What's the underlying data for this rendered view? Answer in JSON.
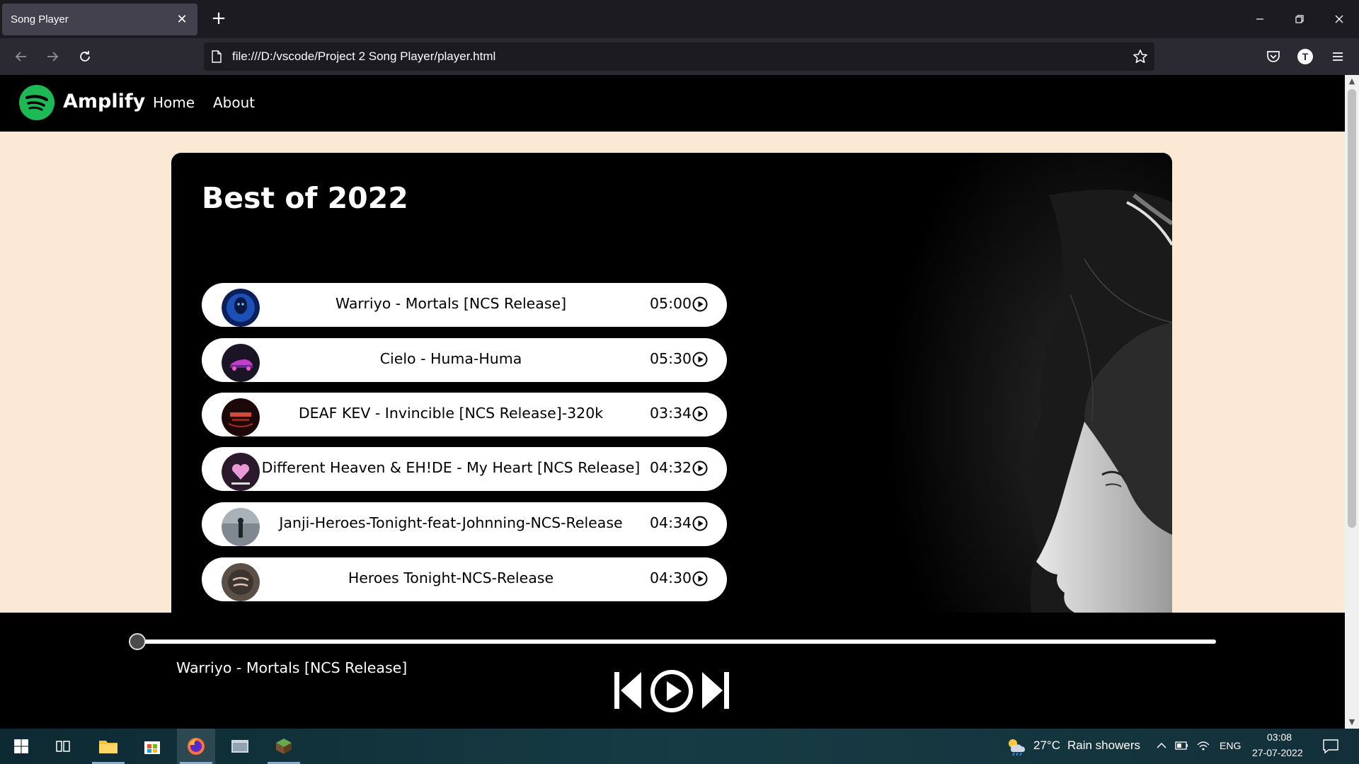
{
  "browser": {
    "tab_title": "Song Player",
    "tab_close": "✕",
    "new_tab": "+",
    "url": "file:///D:/vscode/Project 2 Song Player/player.html",
    "account_initial": "T"
  },
  "site": {
    "brand": "Amplify",
    "nav": [
      "Home",
      "About"
    ],
    "brand_color": "#1db954",
    "page_bg": "#fbe9d6"
  },
  "playlist": {
    "title": "Best of 2022",
    "songs": [
      {
        "name": "Warriyo - Mortals [NCS Release]",
        "duration": "05:00",
        "cover": "blue-figure-cover"
      },
      {
        "name": "Cielo - Huma-Huma",
        "duration": "05:30",
        "cover": "neon-car-cover"
      },
      {
        "name": "DEAF KEV - Invincible [NCS Release]-320k",
        "duration": "03:34",
        "cover": "red-text-cover"
      },
      {
        "name": "Different Heaven & EH!DE - My Heart [NCS Release]",
        "duration": "04:32",
        "cover": "pink-heart-cover"
      },
      {
        "name": "Janji-Heroes-Tonight-feat-Johnning-NCS-Release",
        "duration": "04:34",
        "cover": "foggy-figure-cover"
      },
      {
        "name": "Heroes Tonight-NCS-Release",
        "duration": "04:30",
        "cover": "safety-dance-cover"
      }
    ]
  },
  "player": {
    "now_playing": "Warriyo - Mortals [NCS Release]",
    "progress": 0
  },
  "taskbar": {
    "weather_temp": "27°C",
    "weather_desc": "Rain showers",
    "lang": "ENG",
    "time": "03:08",
    "date": "27-07-2022"
  }
}
